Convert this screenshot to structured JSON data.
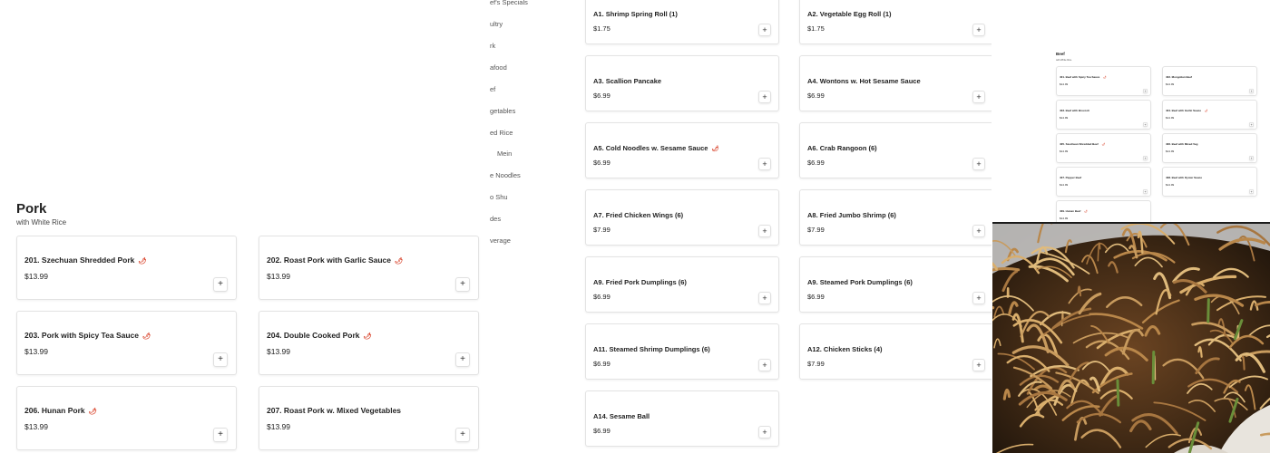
{
  "pork": {
    "title": "Pork",
    "subtitle": "with White Rice",
    "items": [
      {
        "label": "201. Szechuan Shredded Pork",
        "price": "$13.99",
        "spicy": true
      },
      {
        "label": "202. Roast Pork with Garlic Sauce",
        "price": "$13.99",
        "spicy": true
      },
      {
        "label": "203. Pork with Spicy Tea Sauce",
        "price": "$13.99",
        "spicy": true
      },
      {
        "label": "204. Double Cooked Pork",
        "price": "$13.99",
        "spicy": true
      },
      {
        "label": "206. Hunan Pork",
        "price": "$13.99",
        "spicy": true
      },
      {
        "label": "207. Roast Pork w. Mixed Vegetables",
        "price": "$13.99",
        "spicy": false
      }
    ]
  },
  "nav": {
    "items": [
      "ef's Specials",
      "ultry",
      "rk",
      "afood",
      "ef",
      "getables",
      "ed Rice",
      "Mein",
      "e Noodles",
      "o Shu",
      "des",
      "verage"
    ]
  },
  "appetizers": {
    "items": [
      {
        "label": "A1. Shrimp Spring Roll (1)",
        "price": "$1.75",
        "spicy": false
      },
      {
        "label": "A2. Vegetable Egg Roll (1)",
        "price": "$1.75",
        "spicy": false
      },
      {
        "label": "A3. Scallion Pancake",
        "price": "$6.99",
        "spicy": false
      },
      {
        "label": "A4. Wontons w. Hot Sesame Sauce",
        "price": "$6.99",
        "spicy": false
      },
      {
        "label": "A5. Cold Noodles w. Sesame Sauce",
        "price": "$6.99",
        "spicy": true
      },
      {
        "label": "A6. Crab Rangoon (6)",
        "price": "$6.99",
        "spicy": false
      },
      {
        "label": "A7. Fried Chicken Wings (6)",
        "price": "$7.99",
        "spicy": false
      },
      {
        "label": "A8. Fried Jumbo Shrimp (6)",
        "price": "$7.99",
        "spicy": false
      },
      {
        "label": "A9. Fried Pork Dumplings (6)",
        "price": "$6.99",
        "spicy": false
      },
      {
        "label": "A9. Steamed Pork Dumplings (6)",
        "price": "$6.99",
        "spicy": false
      },
      {
        "label": "A11. Steamed Shrimp Dumplings (6)",
        "price": "$6.99",
        "spicy": false
      },
      {
        "label": "A12. Chicken Sticks (4)",
        "price": "$7.99",
        "spicy": false
      },
      {
        "label": "A14. Sesame Ball",
        "price": "$6.99",
        "spicy": false
      }
    ]
  },
  "beef": {
    "title": "Beef",
    "subtitle": "with White Rice",
    "items": [
      {
        "label": "401. Beef with Spicy Tea Sauce",
        "price": "$14.99",
        "spicy": true
      },
      {
        "label": "402. Mongolian Beef",
        "price": "$14.99",
        "spicy": false
      },
      {
        "label": "403. Beef with Broccoli",
        "price": "$14.99",
        "spicy": false
      },
      {
        "label": "404. Beef with Garlic Sauce",
        "price": "$14.99",
        "spicy": true
      },
      {
        "label": "405. Szechuan Shredded Beef",
        "price": "$14.99",
        "spicy": true
      },
      {
        "label": "406. Beef with Mixed Veg",
        "price": "$14.99",
        "spicy": false
      },
      {
        "label": "407. Pepper Beef",
        "price": "$14.99",
        "spicy": false
      },
      {
        "label": "408. Beef with Oyster Sauce",
        "price": "$14.99",
        "spicy": false
      },
      {
        "label": "409. Hunan Beef",
        "price": "$14.99",
        "spicy": true
      }
    ]
  },
  "icons": {
    "add": "+",
    "chili": "🌶"
  },
  "colors": {
    "chili": "#d9442c",
    "border": "#e3e3e3"
  }
}
